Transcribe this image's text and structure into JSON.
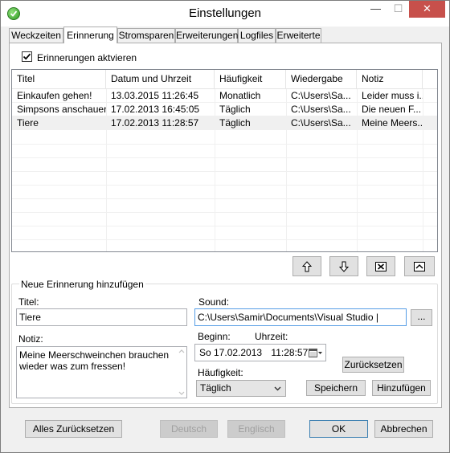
{
  "window": {
    "title": "Einstellungen",
    "minimize_glyph": "—",
    "maximize_glyph": "☐",
    "close_glyph": "✕"
  },
  "tabs": [
    {
      "label": "Weckzeiten",
      "active": false
    },
    {
      "label": "Erinnerung",
      "active": true
    },
    {
      "label": "Stromsparen",
      "active": false
    },
    {
      "label": "Erweiterungen",
      "active": false
    },
    {
      "label": "Logfiles",
      "active": false
    },
    {
      "label": "Erweiterte",
      "active": false
    }
  ],
  "enable_reminders": {
    "label": "Erinnerungen aktvieren",
    "checked": true
  },
  "reminder_list": {
    "columns": [
      "Titel",
      "Datum und Uhrzeit",
      "Häufigkeit",
      "Wiedergabe",
      "Notiz"
    ],
    "rows": [
      {
        "title": "Einkaufen gehen!",
        "datetime": "13.03.2015 11:26:45",
        "frequency": "Monatlich",
        "playback": "C:\\Users\\Sa...",
        "note": "Leider muss i...",
        "selected": false
      },
      {
        "title": "Simpsons anschauen!",
        "datetime": "17.02.2013 16:45:05",
        "frequency": "Täglich",
        "playback": "C:\\Users\\Sa...",
        "note": "Die neuen F...",
        "selected": false
      },
      {
        "title": "Tiere",
        "datetime": "17.02.2013 11:28:57",
        "frequency": "Täglich",
        "playback": "C:\\Users\\Sa...",
        "note": "Meine Meers...",
        "selected": true
      }
    ]
  },
  "list_buttons": [
    {
      "name": "move-up-button",
      "icon": "arrow-up-icon"
    },
    {
      "name": "move-down-button",
      "icon": "arrow-down-icon"
    },
    {
      "name": "delete-button",
      "icon": "delete-box-icon"
    },
    {
      "name": "edit-button",
      "icon": "open-box-icon"
    }
  ],
  "new_reminder": {
    "group_title": "Neue Erinnerung hinzufügen",
    "title_label": "Titel:",
    "title_value": "Tiere",
    "sound_label": "Sound:",
    "sound_value": "C:\\Users\\Samir\\Documents\\Visual Studio |",
    "browse_label": "...",
    "note_label": "Notiz:",
    "note_value": "Meine Meerschweinchen brauchen\nwieder was zum fressen!",
    "begin_label": "Beginn:",
    "time_label": "Uhrzeit:",
    "date_value": "So  17.02.2013",
    "time_value": "11:28:57",
    "reset_label": "Zurücksetzen",
    "frequency_label": "Häufigkeit:",
    "frequency_value": "Täglich",
    "save_label": "Speichern",
    "add_label": "Hinzufügen"
  },
  "footer": {
    "reset_all_label": "Alles Zurücksetzen",
    "german_label": "Deutsch",
    "english_label": "Englisch",
    "ok_label": "OK",
    "cancel_label": "Abbrechen"
  },
  "colors": {
    "close_button": "#c7504b",
    "selection_row": "#f0f0f0",
    "focus_border": "#569de5"
  }
}
